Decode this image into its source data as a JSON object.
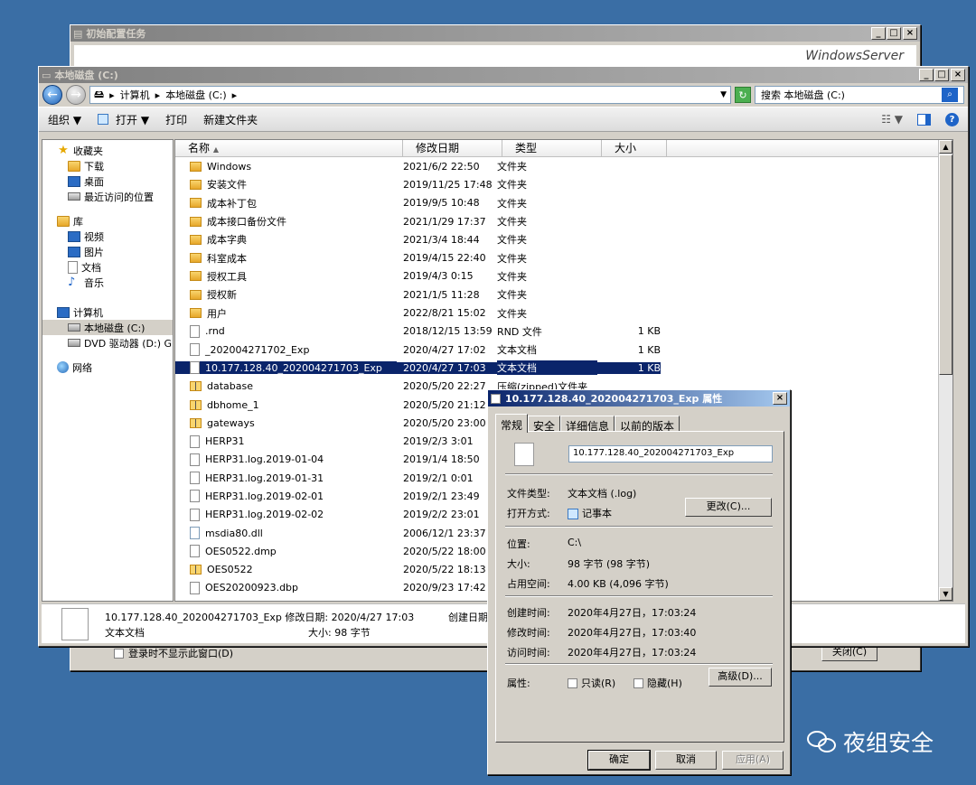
{
  "bg_window": {
    "title": "初始配置任务",
    "brand": "WindowsServer",
    "checkbox_label": "登录时不显示此窗口(D)",
    "close_button": "关闭(C)"
  },
  "explorer": {
    "title": "本地磁盘 (C:)",
    "address": [
      "计算机",
      "本地磁盘 (C:)"
    ],
    "search_placeholder": "搜索 本地磁盘 (C:)",
    "toolbar": {
      "organize": "组织 ▼",
      "open": "打开 ▼",
      "print": "打印",
      "new_folder": "新建文件夹"
    },
    "nav": {
      "favorites": "收藏夹",
      "fav_items": [
        "下载",
        "桌面",
        "最近访问的位置"
      ],
      "libraries": "库",
      "lib_items": [
        "视频",
        "图片",
        "文档",
        "音乐"
      ],
      "computer": "计算机",
      "comp_items": [
        "本地磁盘 (C:)",
        "DVD 驱动器 (D:) GF"
      ],
      "network": "网络"
    },
    "columns": {
      "name": "名称",
      "date": "修改日期",
      "type": "类型",
      "size": "大小"
    },
    "files": [
      {
        "name": "Windows",
        "date": "2021/6/2 22:50",
        "type": "文件夹",
        "size": "",
        "icon": "folder"
      },
      {
        "name": "安装文件",
        "date": "2019/11/25 17:48",
        "type": "文件夹",
        "size": "",
        "icon": "folder"
      },
      {
        "name": "成本补丁包",
        "date": "2019/9/5 10:48",
        "type": "文件夹",
        "size": "",
        "icon": "folder"
      },
      {
        "name": "成本接口备份文件",
        "date": "2021/1/29 17:37",
        "type": "文件夹",
        "size": "",
        "icon": "folder"
      },
      {
        "name": "成本字典",
        "date": "2021/3/4 18:44",
        "type": "文件夹",
        "size": "",
        "icon": "folder"
      },
      {
        "name": "科室成本",
        "date": "2019/4/15 22:40",
        "type": "文件夹",
        "size": "",
        "icon": "folder"
      },
      {
        "name": "授权工具",
        "date": "2019/4/3 0:15",
        "type": "文件夹",
        "size": "",
        "icon": "folder"
      },
      {
        "name": "授权新",
        "date": "2021/1/5 11:28",
        "type": "文件夹",
        "size": "",
        "icon": "folder"
      },
      {
        "name": "用户",
        "date": "2022/8/21 15:02",
        "type": "文件夹",
        "size": "",
        "icon": "folder"
      },
      {
        "name": ".rnd",
        "date": "2018/12/15 13:59",
        "type": "RND 文件",
        "size": "1 KB",
        "icon": "file"
      },
      {
        "name": "_202004271702_Exp",
        "date": "2020/4/27 17:02",
        "type": "文本文档",
        "size": "1 KB",
        "icon": "file"
      },
      {
        "name": "10.177.128.40_202004271703_Exp",
        "date": "2020/4/27 17:03",
        "type": "文本文档",
        "size": "1 KB",
        "icon": "file",
        "selected": true
      },
      {
        "name": "database",
        "date": "2020/5/20 22:27",
        "type": "压缩(zipped)文件夹",
        "size": "",
        "icon": "zip"
      },
      {
        "name": "dbhome_1",
        "date": "2020/5/20 21:12",
        "type": "",
        "size": "",
        "icon": "zip"
      },
      {
        "name": "gateways",
        "date": "2020/5/20 23:00",
        "type": "",
        "size": "",
        "icon": "zip"
      },
      {
        "name": "HERP31",
        "date": "2019/2/3 3:01",
        "type": "",
        "size": "",
        "icon": "file"
      },
      {
        "name": "HERP31.log.2019-01-04",
        "date": "2019/1/4 18:50",
        "type": "",
        "size": "",
        "icon": "file"
      },
      {
        "name": "HERP31.log.2019-01-31",
        "date": "2019/2/1 0:01",
        "type": "",
        "size": "",
        "icon": "file"
      },
      {
        "name": "HERP31.log.2019-02-01",
        "date": "2019/2/1 23:49",
        "type": "",
        "size": "",
        "icon": "file"
      },
      {
        "name": "HERP31.log.2019-02-02",
        "date": "2019/2/2 23:01",
        "type": "",
        "size": "",
        "icon": "file"
      },
      {
        "name": "msdia80.dll",
        "date": "2006/12/1 23:37",
        "type": "",
        "size": "",
        "icon": "dll"
      },
      {
        "name": "OES0522.dmp",
        "date": "2020/5/22 18:00",
        "type": "",
        "size": "",
        "icon": "file"
      },
      {
        "name": "OES0522",
        "date": "2020/5/22 18:13",
        "type": "",
        "size": "",
        "icon": "zip"
      },
      {
        "name": "OES20200923.dbp",
        "date": "2020/9/23 17:42",
        "type": "",
        "size": "",
        "icon": "file"
      }
    ],
    "details": {
      "line1": "10.177.128.40_202004271703_Exp 修改日期: 2020/4/27 17:03",
      "type": "文本文档",
      "size": "大小: 98 字节",
      "created": "创建日期"
    }
  },
  "props": {
    "title": "10.177.128.40_202004271703_Exp 属性",
    "tabs": [
      "常规",
      "安全",
      "详细信息",
      "以前的版本"
    ],
    "filename": "10.177.128.40_202004271703_Exp",
    "file_type_label": "文件类型:",
    "file_type": "文本文档 (.log)",
    "open_with_label": "打开方式:",
    "open_with": "记事本",
    "change_button": "更改(C)...",
    "location_label": "位置:",
    "location": "C:\\",
    "size_label": "大小:",
    "size": "98 字节 (98 字节)",
    "disk_label": "占用空间:",
    "disk": "4.00 KB (4,096 字节)",
    "created_label": "创建时间:",
    "created": "2020年4月27日，17:03:24",
    "modified_label": "修改时间:",
    "modified": "2020年4月27日，17:03:40",
    "accessed_label": "访问时间:",
    "accessed": "2020年4月27日，17:03:24",
    "attr_label": "属性:",
    "readonly": "只读(R)",
    "hidden": "隐藏(H)",
    "advanced_button": "高级(D)...",
    "ok": "确定",
    "cancel": "取消",
    "apply": "应用(A)"
  },
  "watermark": "夜组安全"
}
